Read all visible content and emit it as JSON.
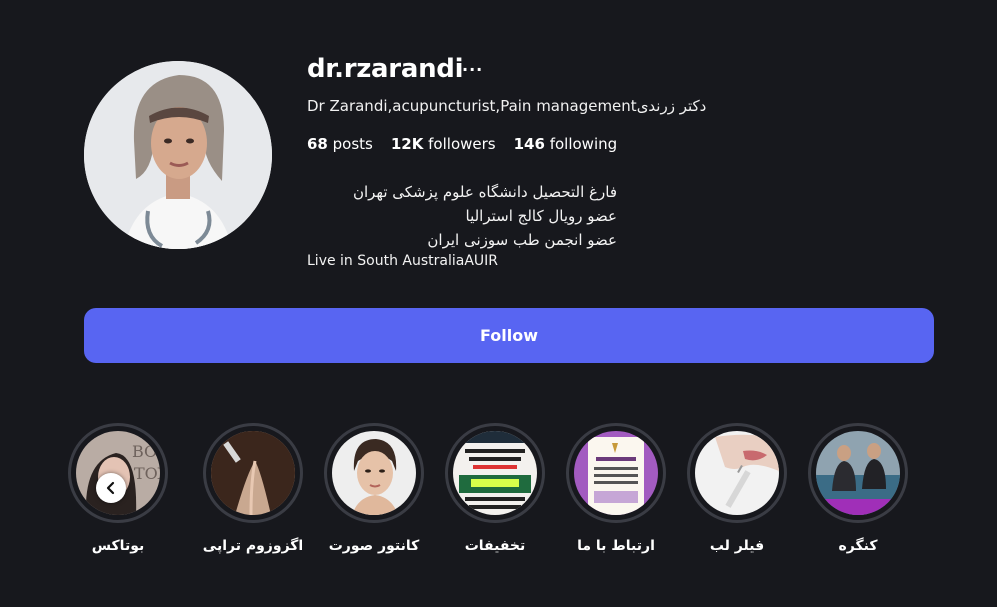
{
  "profile": {
    "username": "dr.rzarandi",
    "more_label": "···",
    "full_name": "Dr Zarandi,acupuncturist,Pain management‏دکتر زرندی",
    "stats": {
      "posts_count": "68",
      "posts_label": "posts",
      "followers_count": "12K",
      "followers_label": "followers",
      "following_count": "146",
      "following_label": "following"
    },
    "bio": [
      "فارغ التحصیل دانشگاه علوم پزشکی تهران",
      "عضو رویال کالج استرالیا",
      "عضو انجمن طب سوزنی ایران",
      "Live in South AustraliaAUIR"
    ]
  },
  "follow_label": "Follow",
  "highlights": [
    {
      "label": "بوتاکس"
    },
    {
      "label": "اگزوزوم تراپی"
    },
    {
      "label": "کانتور صورت"
    },
    {
      "label": "تخفیفات"
    },
    {
      "label": "ارتباط با ما"
    },
    {
      "label": "فیلر لب"
    },
    {
      "label": "کنگره"
    }
  ],
  "colors": {
    "background": "#17181d",
    "accent": "#5865f2",
    "ring": "#3a3c44"
  }
}
